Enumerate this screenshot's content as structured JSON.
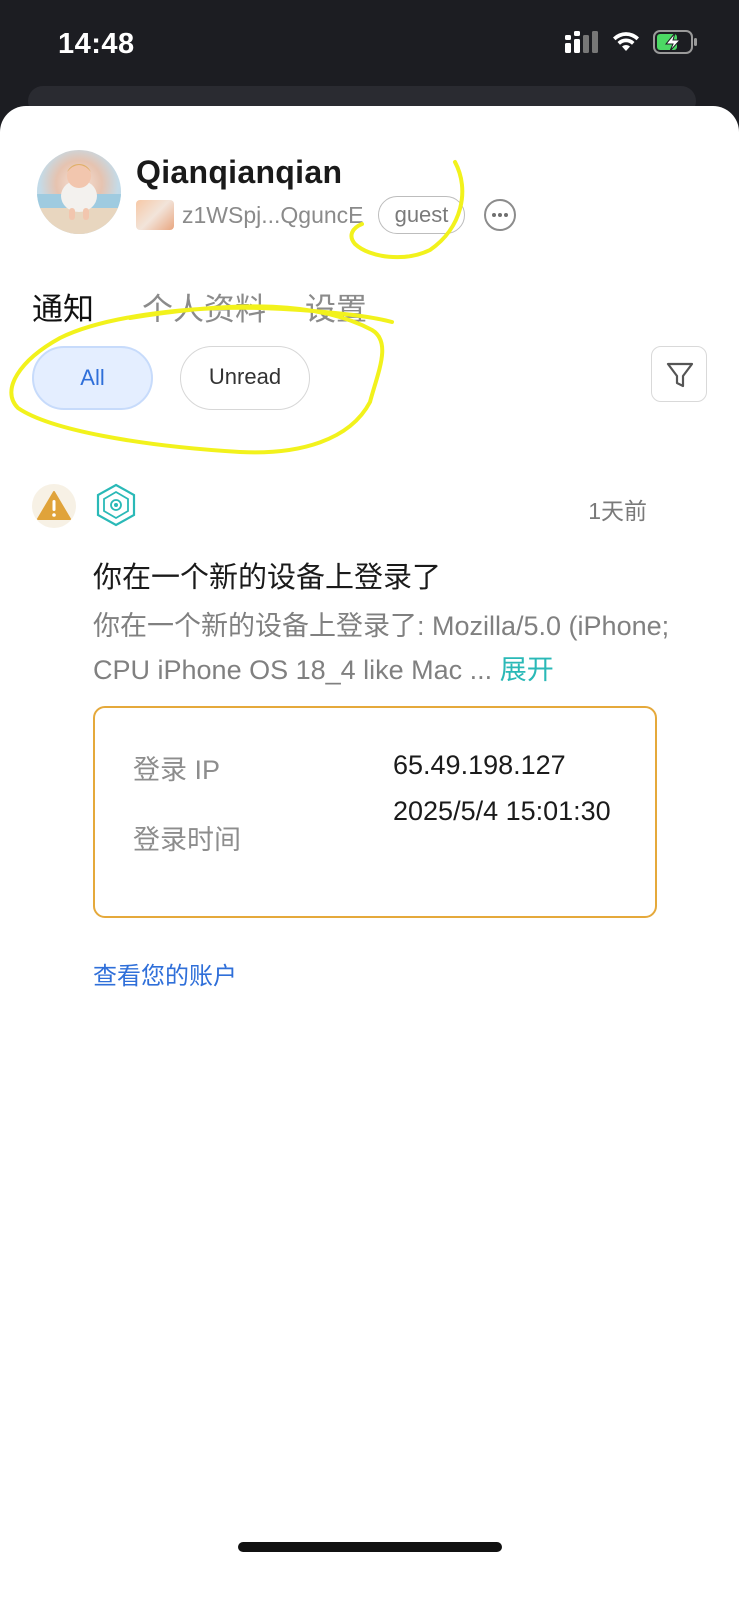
{
  "status_bar": {
    "time": "14:48"
  },
  "profile": {
    "username": "Qianqianqian",
    "address": "z1WSpj...QguncE",
    "role_badge": "guest"
  },
  "tabs": [
    {
      "label": "通知",
      "active": true
    },
    {
      "label": "个人资料",
      "active": false
    },
    {
      "label": "设置",
      "active": false
    }
  ],
  "filters": {
    "all_label": "All",
    "unread_label": "Unread",
    "selected": "All"
  },
  "notification": {
    "time_ago": "1天前",
    "title": "你在一个新的设备上登录了",
    "body": "你在一个新的设备上登录了: Mozilla/5.0 (iPhone; CPU iPhone OS 18_4 like Mac ...",
    "expand_label": "展开",
    "details": {
      "ip_label": "登录 IP",
      "ip_value": "65.49.198.127",
      "time_label": "登录时间",
      "time_value": "2025/5/4 15:01:30"
    },
    "link_label": "查看您的账户"
  },
  "colors": {
    "accent_blue": "#2f6fd9",
    "expand_teal": "#2ab9b7",
    "card_border": "#e5a93b",
    "warning": "#e0a33a",
    "annotation": "#f2f21c"
  },
  "icons": [
    "signal-icon",
    "wifi-icon",
    "battery-charging-icon",
    "more-icon",
    "filter-icon",
    "warning-icon",
    "hexagon-gear-icon"
  ]
}
